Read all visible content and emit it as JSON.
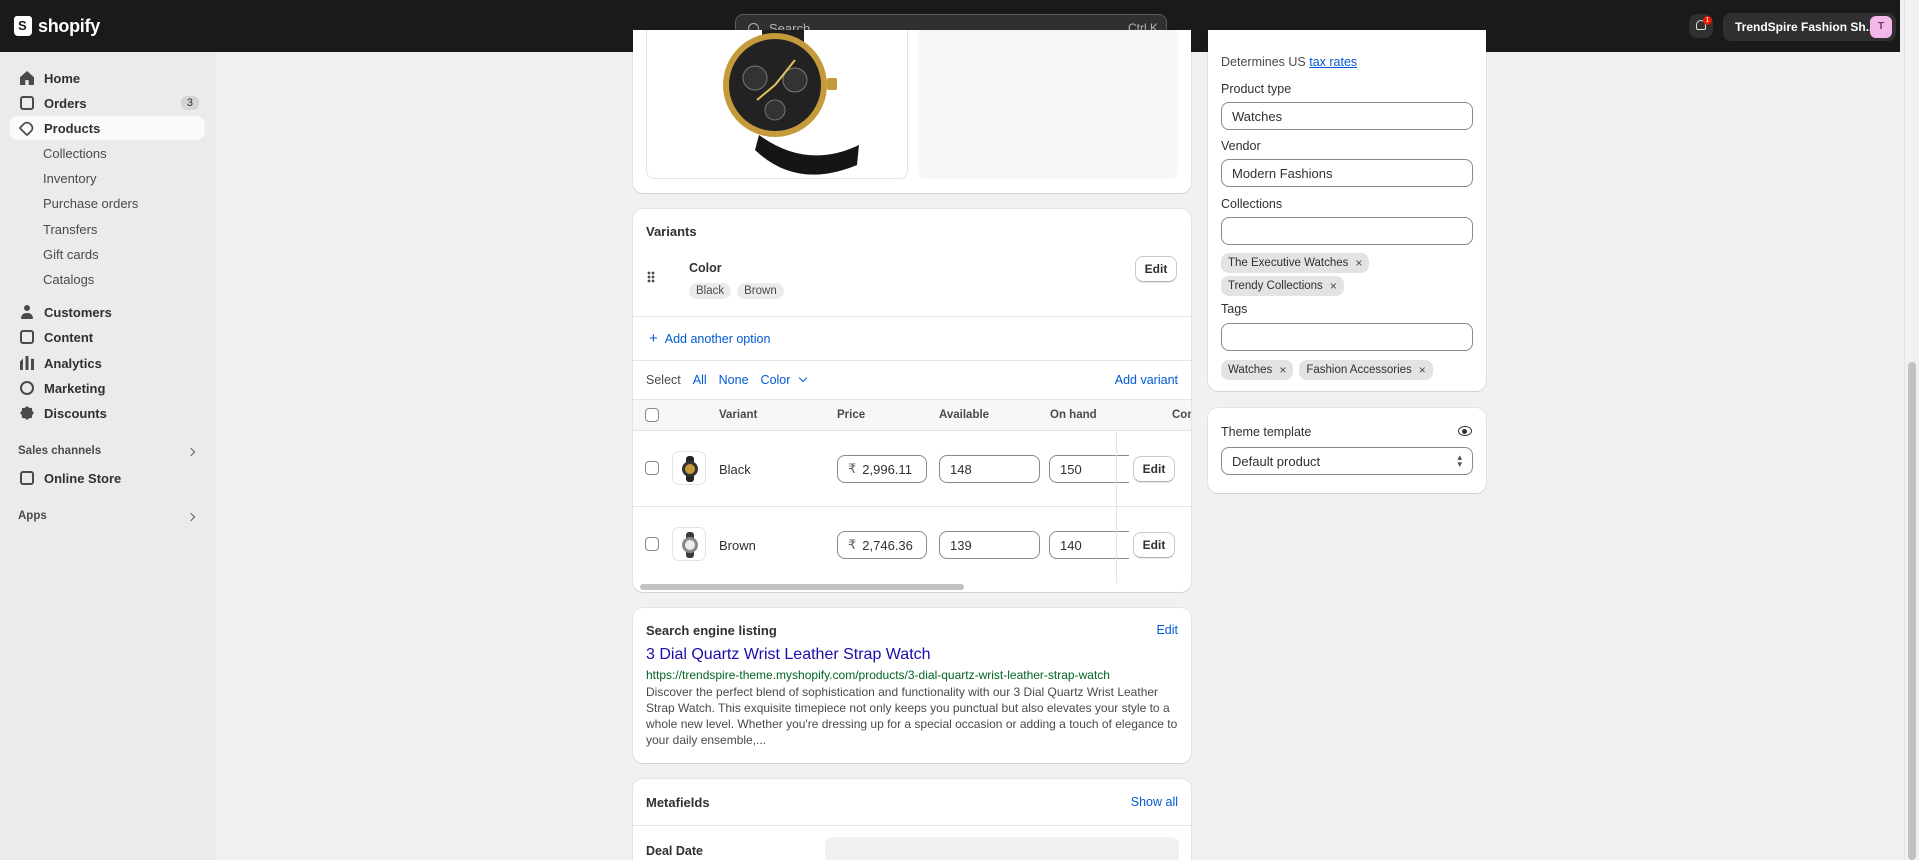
{
  "topbar": {
    "logo": "shopify",
    "search_placeholder": "Search",
    "search_shortcut": "Ctrl K",
    "notification_count": "1",
    "store_name": "TrendSpire Fashion Sh...",
    "avatar_initials": "T"
  },
  "sidebar": {
    "items": [
      {
        "label": "Home",
        "icon": "home-icon"
      },
      {
        "label": "Orders",
        "icon": "orders-icon",
        "badge": "3"
      },
      {
        "label": "Products",
        "icon": "tag-icon"
      },
      {
        "label": "Collections"
      },
      {
        "label": "Inventory"
      },
      {
        "label": "Purchase orders"
      },
      {
        "label": "Transfers"
      },
      {
        "label": "Gift cards"
      },
      {
        "label": "Catalogs"
      },
      {
        "label": "Customers",
        "icon": "person-icon"
      },
      {
        "label": "Content",
        "icon": "content-icon"
      },
      {
        "label": "Analytics",
        "icon": "analytics-icon"
      },
      {
        "label": "Marketing",
        "icon": "marketing-icon"
      },
      {
        "label": "Discounts",
        "icon": "discount-icon"
      },
      {
        "label": "Online Store",
        "icon": "store-icon"
      }
    ],
    "sales_channels": "Sales channels",
    "apps": "Apps"
  },
  "variants": {
    "title": "Variants",
    "option_name": "Color",
    "option_values": [
      "Black",
      "Brown"
    ],
    "edit": "Edit",
    "add_option": "Add another option",
    "select_label": "Select",
    "select_all": "All",
    "select_none": "None",
    "select_color": "Color",
    "add_variant": "Add variant",
    "columns": [
      "Variant",
      "Price",
      "Available",
      "On hand",
      "Com"
    ],
    "currency": "₹",
    "rows": [
      {
        "name": "Black",
        "price": "2,996.11",
        "available": "148",
        "on_hand": "150",
        "edit": "Edit"
      },
      {
        "name": "Brown",
        "price": "2,746.36",
        "available": "139",
        "on_hand": "140",
        "edit": "Edit"
      }
    ]
  },
  "seo": {
    "title": "Search engine listing",
    "edit": "Edit",
    "page_title": "3 Dial Quartz Wrist Leather Strap Watch",
    "url": "https://trendspire-theme.myshopify.com/products/3-dial-quartz-wrist-leather-strap-watch",
    "description": "Discover the perfect blend of sophistication and functionality with our 3 Dial Quartz Wrist Leather Strap Watch. This exquisite timepiece not only keeps you punctual but also elevates your style to a whole new level. Whether you're dressing up for a special occasion or adding a touch of elegance to your daily ensemble,..."
  },
  "metafields": {
    "title": "Metafields",
    "show_all": "Show all",
    "first_label": "Deal Date"
  },
  "organization": {
    "tax_prefix": "Determines US",
    "tax_link": "tax rates",
    "product_type_label": "Product type",
    "product_type_value": "Watches",
    "vendor_label": "Vendor",
    "vendor_value": "Modern Fashions",
    "collections_label": "Collections",
    "collections": [
      "The Executive Watches",
      "Trendy Collections"
    ],
    "tags_label": "Tags",
    "tags": [
      "Watches",
      "Fashion Accessories"
    ],
    "remove_glyph": "×"
  },
  "theme": {
    "label": "Theme template",
    "value": "Default product"
  },
  "colors": {
    "accent": "#005bd3",
    "seo_title": "#1a0dab",
    "seo_url": "#006621",
    "topbar": "#1a1a1a"
  }
}
